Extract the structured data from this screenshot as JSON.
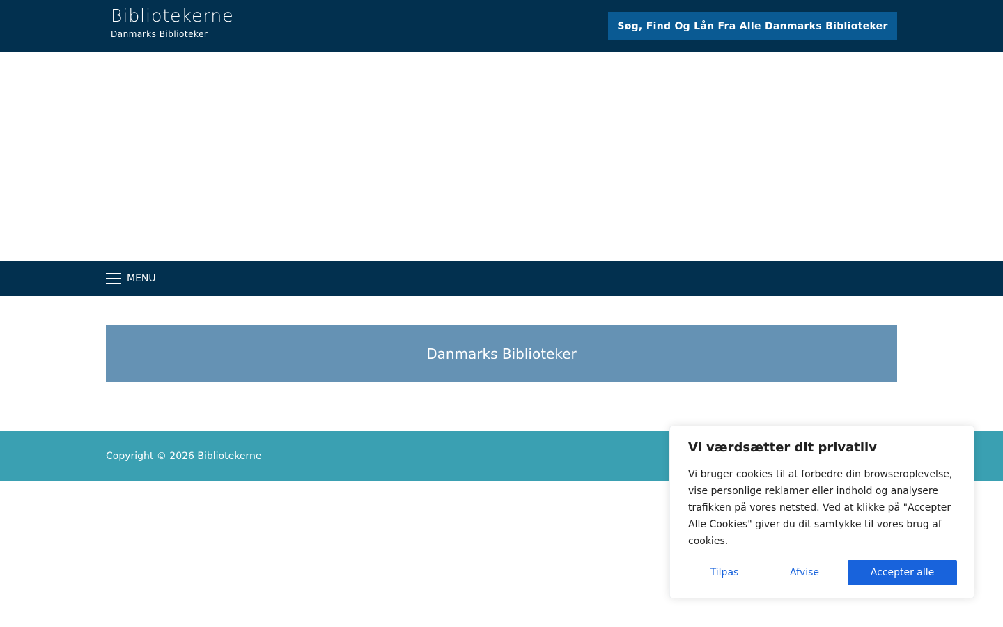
{
  "header": {
    "site_title": "Bibliotekerne",
    "tagline": "Danmarks Biblioteker",
    "cta_label": "Søg, Find Og Lån Fra Alle Danmarks Biblioteker"
  },
  "nav": {
    "menu_label": "MENU",
    "menu_icon": "hamburger-menu-icon"
  },
  "main": {
    "banner_title": "Danmarks Biblioteker"
  },
  "footer": {
    "copyright": "Copyright © 2026 Bibliotekerne"
  },
  "cookie_consent": {
    "title": "Vi værdsætter dit privatliv",
    "body": "Vi bruger cookies til at forbedre din browseroplevelse, vise personlige reklamer eller indhold og analysere trafikken på vores netsted. Ved at klikke på \"Accepter Alle Cookies\" giver du dit samtykke til vores brug af cookies.",
    "customize_label": "Tilpas",
    "reject_label": "Afvise",
    "accept_label": "Accepter alle"
  },
  "colors": {
    "header_bg": "#02304f",
    "cta_bg": "#0a5a93",
    "banner_bg": "#6592b4",
    "footer_bg": "#3aa0b2",
    "cookie_accent": "#1863dc"
  }
}
